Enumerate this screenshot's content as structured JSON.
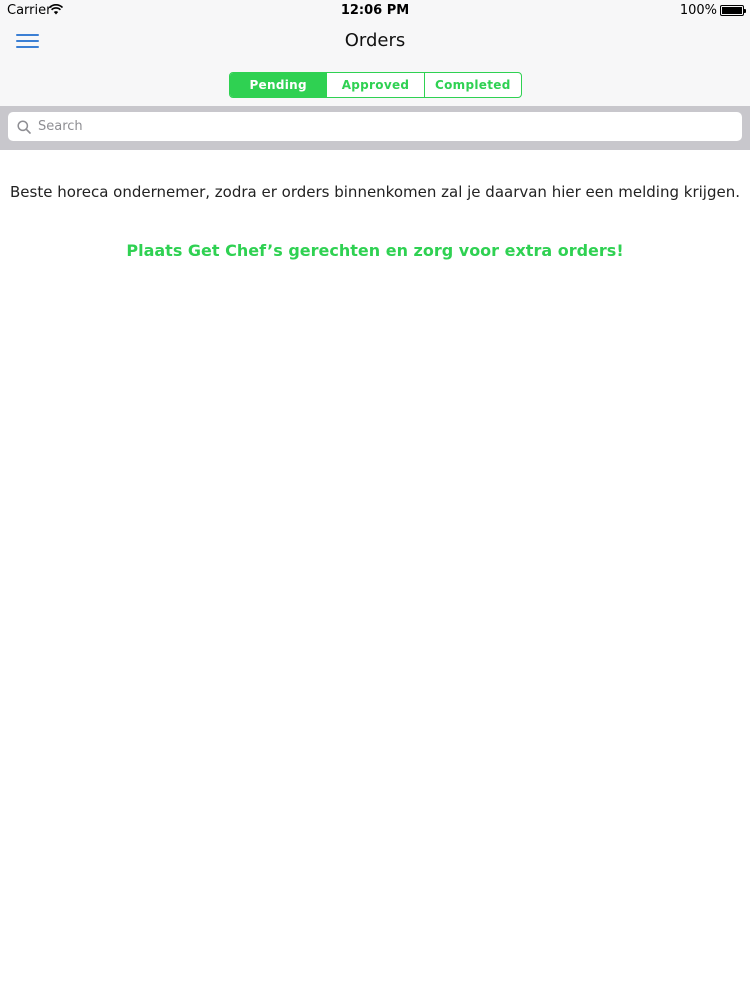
{
  "status_bar": {
    "carrier": "Carrier",
    "time": "12:06 PM",
    "battery": "100%",
    "wifi_icon": "wifi-icon",
    "battery_icon": "battery-icon"
  },
  "nav": {
    "title": "Orders",
    "menu_icon": "hamburger-menu-icon"
  },
  "tabs": [
    {
      "label": "Pending",
      "active": true
    },
    {
      "label": "Approved",
      "active": false
    },
    {
      "label": "Completed",
      "active": false
    }
  ],
  "search": {
    "placeholder": "Search",
    "value": "",
    "icon": "search-icon"
  },
  "content": {
    "info": "Beste horeca ondernemer, zodra er orders binnenkomen zal je daarvan hier een melding krijgen.",
    "promo": "Plaats Get Chef’s gerechten en zorg voor extra orders!"
  },
  "colors": {
    "accent": "#2fd152",
    "menu_icon": "#3b7fd4",
    "nav_background": "#f7f7f8",
    "search_background": "#c8c7cc"
  }
}
